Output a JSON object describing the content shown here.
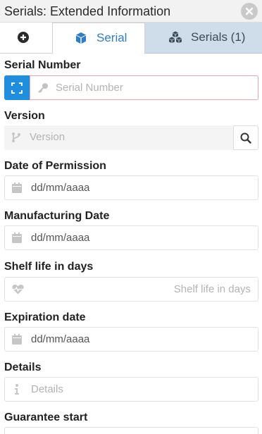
{
  "window": {
    "title": "Serials: Extended Information"
  },
  "tabs": {
    "serial_label": "Serial",
    "serials_label": "Serials (1)"
  },
  "fields": {
    "serial_number": {
      "label": "Serial Number",
      "placeholder": "Serial Number"
    },
    "version": {
      "label": "Version",
      "placeholder": "Version"
    },
    "date_of_permission": {
      "label": "Date of Permission",
      "value": "dd/mm/aaaa"
    },
    "manufacturing_date": {
      "label": "Manufacturing Date",
      "value": "dd/mm/aaaa"
    },
    "shelf_life": {
      "label": "Shelf life in days",
      "placeholder": "Shelf life in days"
    },
    "expiration_date": {
      "label": "Expiration date",
      "value": "dd/mm/aaaa"
    },
    "details": {
      "label": "Details",
      "placeholder": "Details"
    },
    "guarantee_start": {
      "label": "Guarantee start"
    }
  },
  "colors": {
    "accent": "#1f8ee0",
    "active_tab_text": "#2f7dc4",
    "inactive_tab_bg": "#cfdce9",
    "invalid_border": "#e7a3b2"
  }
}
